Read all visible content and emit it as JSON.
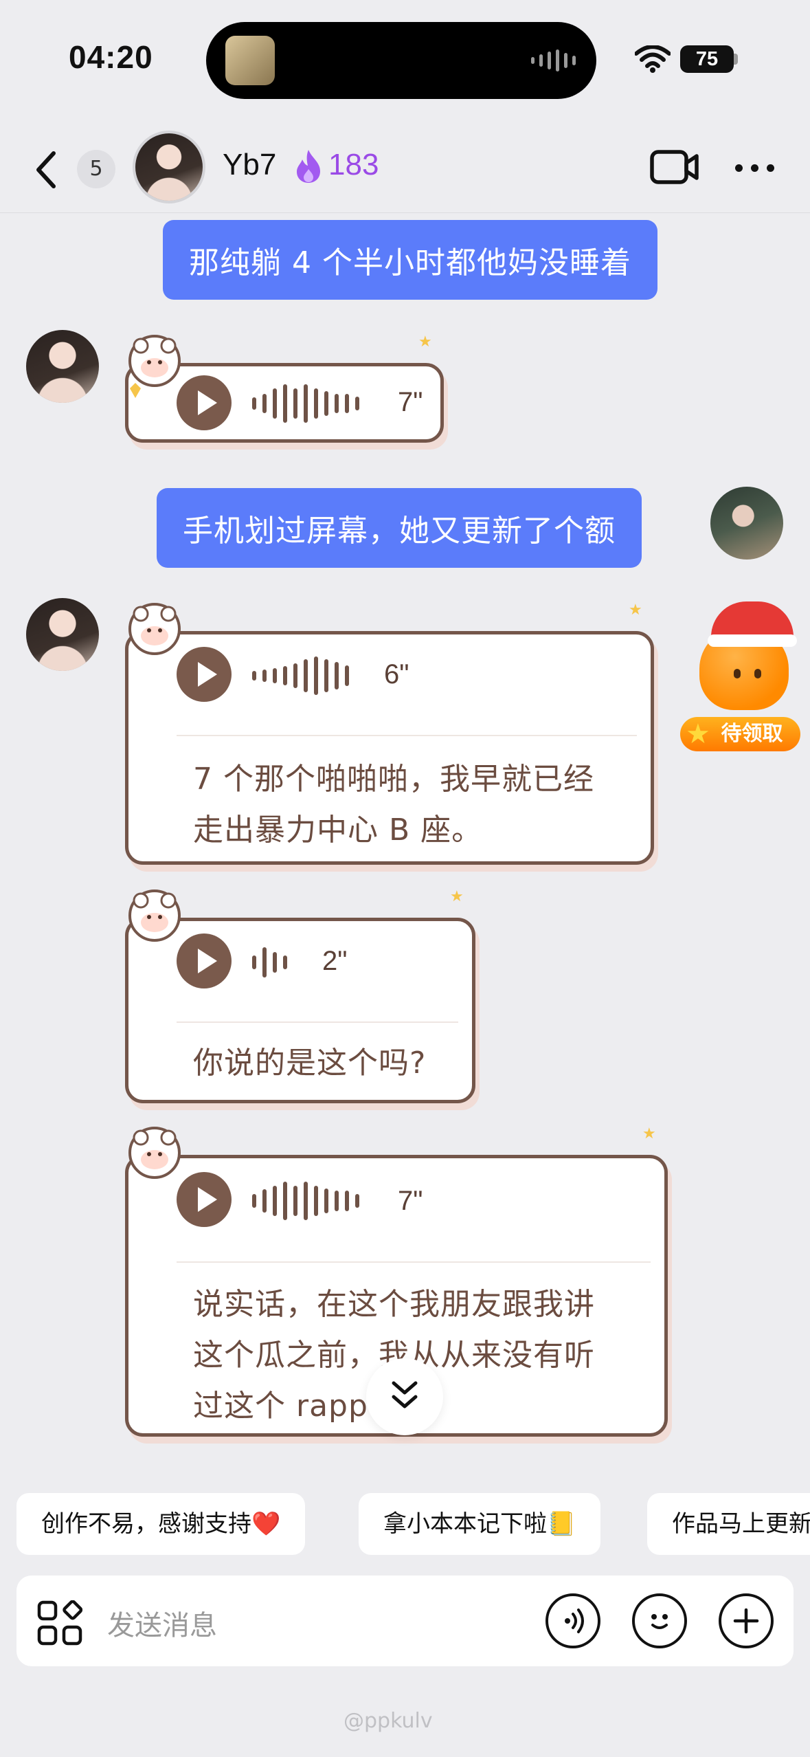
{
  "status_bar": {
    "time": "04:20",
    "battery": "75"
  },
  "header": {
    "unread_count": "5",
    "contact_name": "Yb7",
    "streak_count": "183"
  },
  "messages": [
    {
      "side": "sent",
      "type": "text",
      "text": "那纯躺 4 个半小时都他妈没睡着"
    },
    {
      "side": "received",
      "type": "voice",
      "duration": "7\""
    },
    {
      "side": "sent",
      "type": "text",
      "text": "手机划过屏幕，她又更新了个额"
    },
    {
      "side": "received",
      "type": "voice",
      "duration": "6\"",
      "transcript_lines": [
        "7 个那个啪啪啪，我早就已经",
        "走出暴力中心 B 座。"
      ]
    },
    {
      "side": "received",
      "type": "voice",
      "duration": "2\"",
      "transcript_lines": [
        "你说的是这个吗?"
      ]
    },
    {
      "side": "received",
      "type": "voice",
      "duration": "7\"",
      "transcript_lines": [
        "说实话，在这个我朋友跟我讲",
        "这个瓜之前，我从从来没有听",
        "过这个 rapp"
      ]
    }
  ],
  "reward": {
    "label": "待领取"
  },
  "quick_replies": [
    "创作不易，感谢支持❤️",
    "拿小本本记下啦📒",
    "作品马上更新"
  ],
  "input": {
    "placeholder": "发送消息"
  },
  "watermark": "@ppkulv",
  "colors": {
    "sent_bubble": "#5b7cfa",
    "card_border": "#74564a",
    "streak": "#9a4ae6"
  }
}
